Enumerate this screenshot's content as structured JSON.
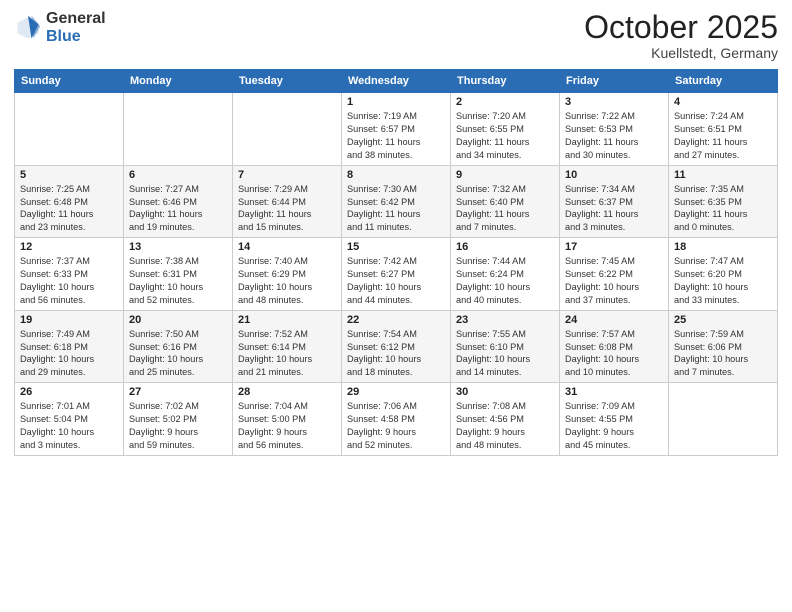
{
  "header": {
    "logo": {
      "general": "General",
      "blue": "Blue"
    },
    "title": "October 2025",
    "location": "Kuellstedt, Germany"
  },
  "calendar": {
    "weekdays": [
      "Sunday",
      "Monday",
      "Tuesday",
      "Wednesday",
      "Thursday",
      "Friday",
      "Saturday"
    ],
    "weeks": [
      [
        {
          "day": "",
          "info": ""
        },
        {
          "day": "",
          "info": ""
        },
        {
          "day": "",
          "info": ""
        },
        {
          "day": "1",
          "info": "Sunrise: 7:19 AM\nSunset: 6:57 PM\nDaylight: 11 hours\nand 38 minutes."
        },
        {
          "day": "2",
          "info": "Sunrise: 7:20 AM\nSunset: 6:55 PM\nDaylight: 11 hours\nand 34 minutes."
        },
        {
          "day": "3",
          "info": "Sunrise: 7:22 AM\nSunset: 6:53 PM\nDaylight: 11 hours\nand 30 minutes."
        },
        {
          "day": "4",
          "info": "Sunrise: 7:24 AM\nSunset: 6:51 PM\nDaylight: 11 hours\nand 27 minutes."
        }
      ],
      [
        {
          "day": "5",
          "info": "Sunrise: 7:25 AM\nSunset: 6:48 PM\nDaylight: 11 hours\nand 23 minutes."
        },
        {
          "day": "6",
          "info": "Sunrise: 7:27 AM\nSunset: 6:46 PM\nDaylight: 11 hours\nand 19 minutes."
        },
        {
          "day": "7",
          "info": "Sunrise: 7:29 AM\nSunset: 6:44 PM\nDaylight: 11 hours\nand 15 minutes."
        },
        {
          "day": "8",
          "info": "Sunrise: 7:30 AM\nSunset: 6:42 PM\nDaylight: 11 hours\nand 11 minutes."
        },
        {
          "day": "9",
          "info": "Sunrise: 7:32 AM\nSunset: 6:40 PM\nDaylight: 11 hours\nand 7 minutes."
        },
        {
          "day": "10",
          "info": "Sunrise: 7:34 AM\nSunset: 6:37 PM\nDaylight: 11 hours\nand 3 minutes."
        },
        {
          "day": "11",
          "info": "Sunrise: 7:35 AM\nSunset: 6:35 PM\nDaylight: 11 hours\nand 0 minutes."
        }
      ],
      [
        {
          "day": "12",
          "info": "Sunrise: 7:37 AM\nSunset: 6:33 PM\nDaylight: 10 hours\nand 56 minutes."
        },
        {
          "day": "13",
          "info": "Sunrise: 7:38 AM\nSunset: 6:31 PM\nDaylight: 10 hours\nand 52 minutes."
        },
        {
          "day": "14",
          "info": "Sunrise: 7:40 AM\nSunset: 6:29 PM\nDaylight: 10 hours\nand 48 minutes."
        },
        {
          "day": "15",
          "info": "Sunrise: 7:42 AM\nSunset: 6:27 PM\nDaylight: 10 hours\nand 44 minutes."
        },
        {
          "day": "16",
          "info": "Sunrise: 7:44 AM\nSunset: 6:24 PM\nDaylight: 10 hours\nand 40 minutes."
        },
        {
          "day": "17",
          "info": "Sunrise: 7:45 AM\nSunset: 6:22 PM\nDaylight: 10 hours\nand 37 minutes."
        },
        {
          "day": "18",
          "info": "Sunrise: 7:47 AM\nSunset: 6:20 PM\nDaylight: 10 hours\nand 33 minutes."
        }
      ],
      [
        {
          "day": "19",
          "info": "Sunrise: 7:49 AM\nSunset: 6:18 PM\nDaylight: 10 hours\nand 29 minutes."
        },
        {
          "day": "20",
          "info": "Sunrise: 7:50 AM\nSunset: 6:16 PM\nDaylight: 10 hours\nand 25 minutes."
        },
        {
          "day": "21",
          "info": "Sunrise: 7:52 AM\nSunset: 6:14 PM\nDaylight: 10 hours\nand 21 minutes."
        },
        {
          "day": "22",
          "info": "Sunrise: 7:54 AM\nSunset: 6:12 PM\nDaylight: 10 hours\nand 18 minutes."
        },
        {
          "day": "23",
          "info": "Sunrise: 7:55 AM\nSunset: 6:10 PM\nDaylight: 10 hours\nand 14 minutes."
        },
        {
          "day": "24",
          "info": "Sunrise: 7:57 AM\nSunset: 6:08 PM\nDaylight: 10 hours\nand 10 minutes."
        },
        {
          "day": "25",
          "info": "Sunrise: 7:59 AM\nSunset: 6:06 PM\nDaylight: 10 hours\nand 7 minutes."
        }
      ],
      [
        {
          "day": "26",
          "info": "Sunrise: 7:01 AM\nSunset: 5:04 PM\nDaylight: 10 hours\nand 3 minutes."
        },
        {
          "day": "27",
          "info": "Sunrise: 7:02 AM\nSunset: 5:02 PM\nDaylight: 9 hours\nand 59 minutes."
        },
        {
          "day": "28",
          "info": "Sunrise: 7:04 AM\nSunset: 5:00 PM\nDaylight: 9 hours\nand 56 minutes."
        },
        {
          "day": "29",
          "info": "Sunrise: 7:06 AM\nSunset: 4:58 PM\nDaylight: 9 hours\nand 52 minutes."
        },
        {
          "day": "30",
          "info": "Sunrise: 7:08 AM\nSunset: 4:56 PM\nDaylight: 9 hours\nand 48 minutes."
        },
        {
          "day": "31",
          "info": "Sunrise: 7:09 AM\nSunset: 4:55 PM\nDaylight: 9 hours\nand 45 minutes."
        },
        {
          "day": "",
          "info": ""
        }
      ]
    ]
  }
}
